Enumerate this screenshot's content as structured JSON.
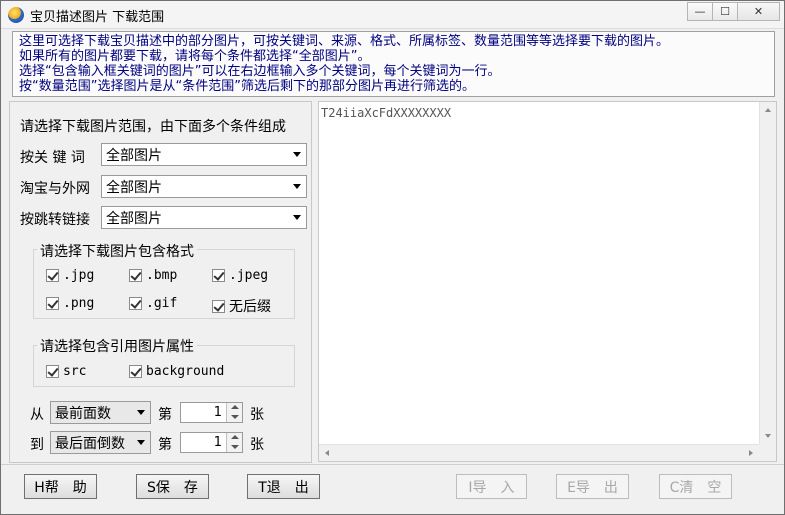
{
  "window": {
    "title": "宝贝描述图片 下载范围",
    "minimize_glyph": "—",
    "maximize_glyph": "☐",
    "close_glyph": "✕"
  },
  "info": {
    "lines": [
      "这里可选择下载宝贝描述中的部分图片，可按关键词、来源、格式、所属标签、数量范围等等选择要下载的图片。",
      "如果所有的图片都要下载，请将每个条件都选择“全部图片”。",
      "选择“包含输入框关键词的图片”可以在右边框输入多个关键词，每个关键词为一行。",
      "按“数量范围”选择图片是从“条件范围”筛选后剩下的那部分图片再进行筛选的。"
    ]
  },
  "filters": {
    "heading": "请选择下载图片范围，由下面多个条件组成",
    "keyword_label": "按关 键 词",
    "keyword_value": "全部图片",
    "source_label": "淘宝与外网",
    "source_value": "全部图片",
    "link_label": "按跳转链接",
    "link_value": "全部图片"
  },
  "formats": {
    "title": "请选择下载图片包含格式",
    "items": [
      ".jpg",
      ".bmp",
      ".jpeg",
      ".png",
      ".gif",
      "无后缀"
    ]
  },
  "attributes": {
    "title": "请选择包含引用图片属性",
    "items": [
      "src",
      "background"
    ]
  },
  "range": {
    "from_label": "从",
    "from_select": "最前面数",
    "from_nth": "第",
    "from_value": "1",
    "from_unit": "张",
    "to_label": "到",
    "to_select": "最后面倒数",
    "to_nth": "第",
    "to_value": "1",
    "to_unit": "张"
  },
  "keywords_text": "T24iiaXcFdXXXXXXXX",
  "buttons": {
    "help": "H帮　助",
    "save": "S保　存",
    "exit": "T退　出",
    "import": "I导　入",
    "export": "E导　出",
    "clear": "C清　空"
  }
}
